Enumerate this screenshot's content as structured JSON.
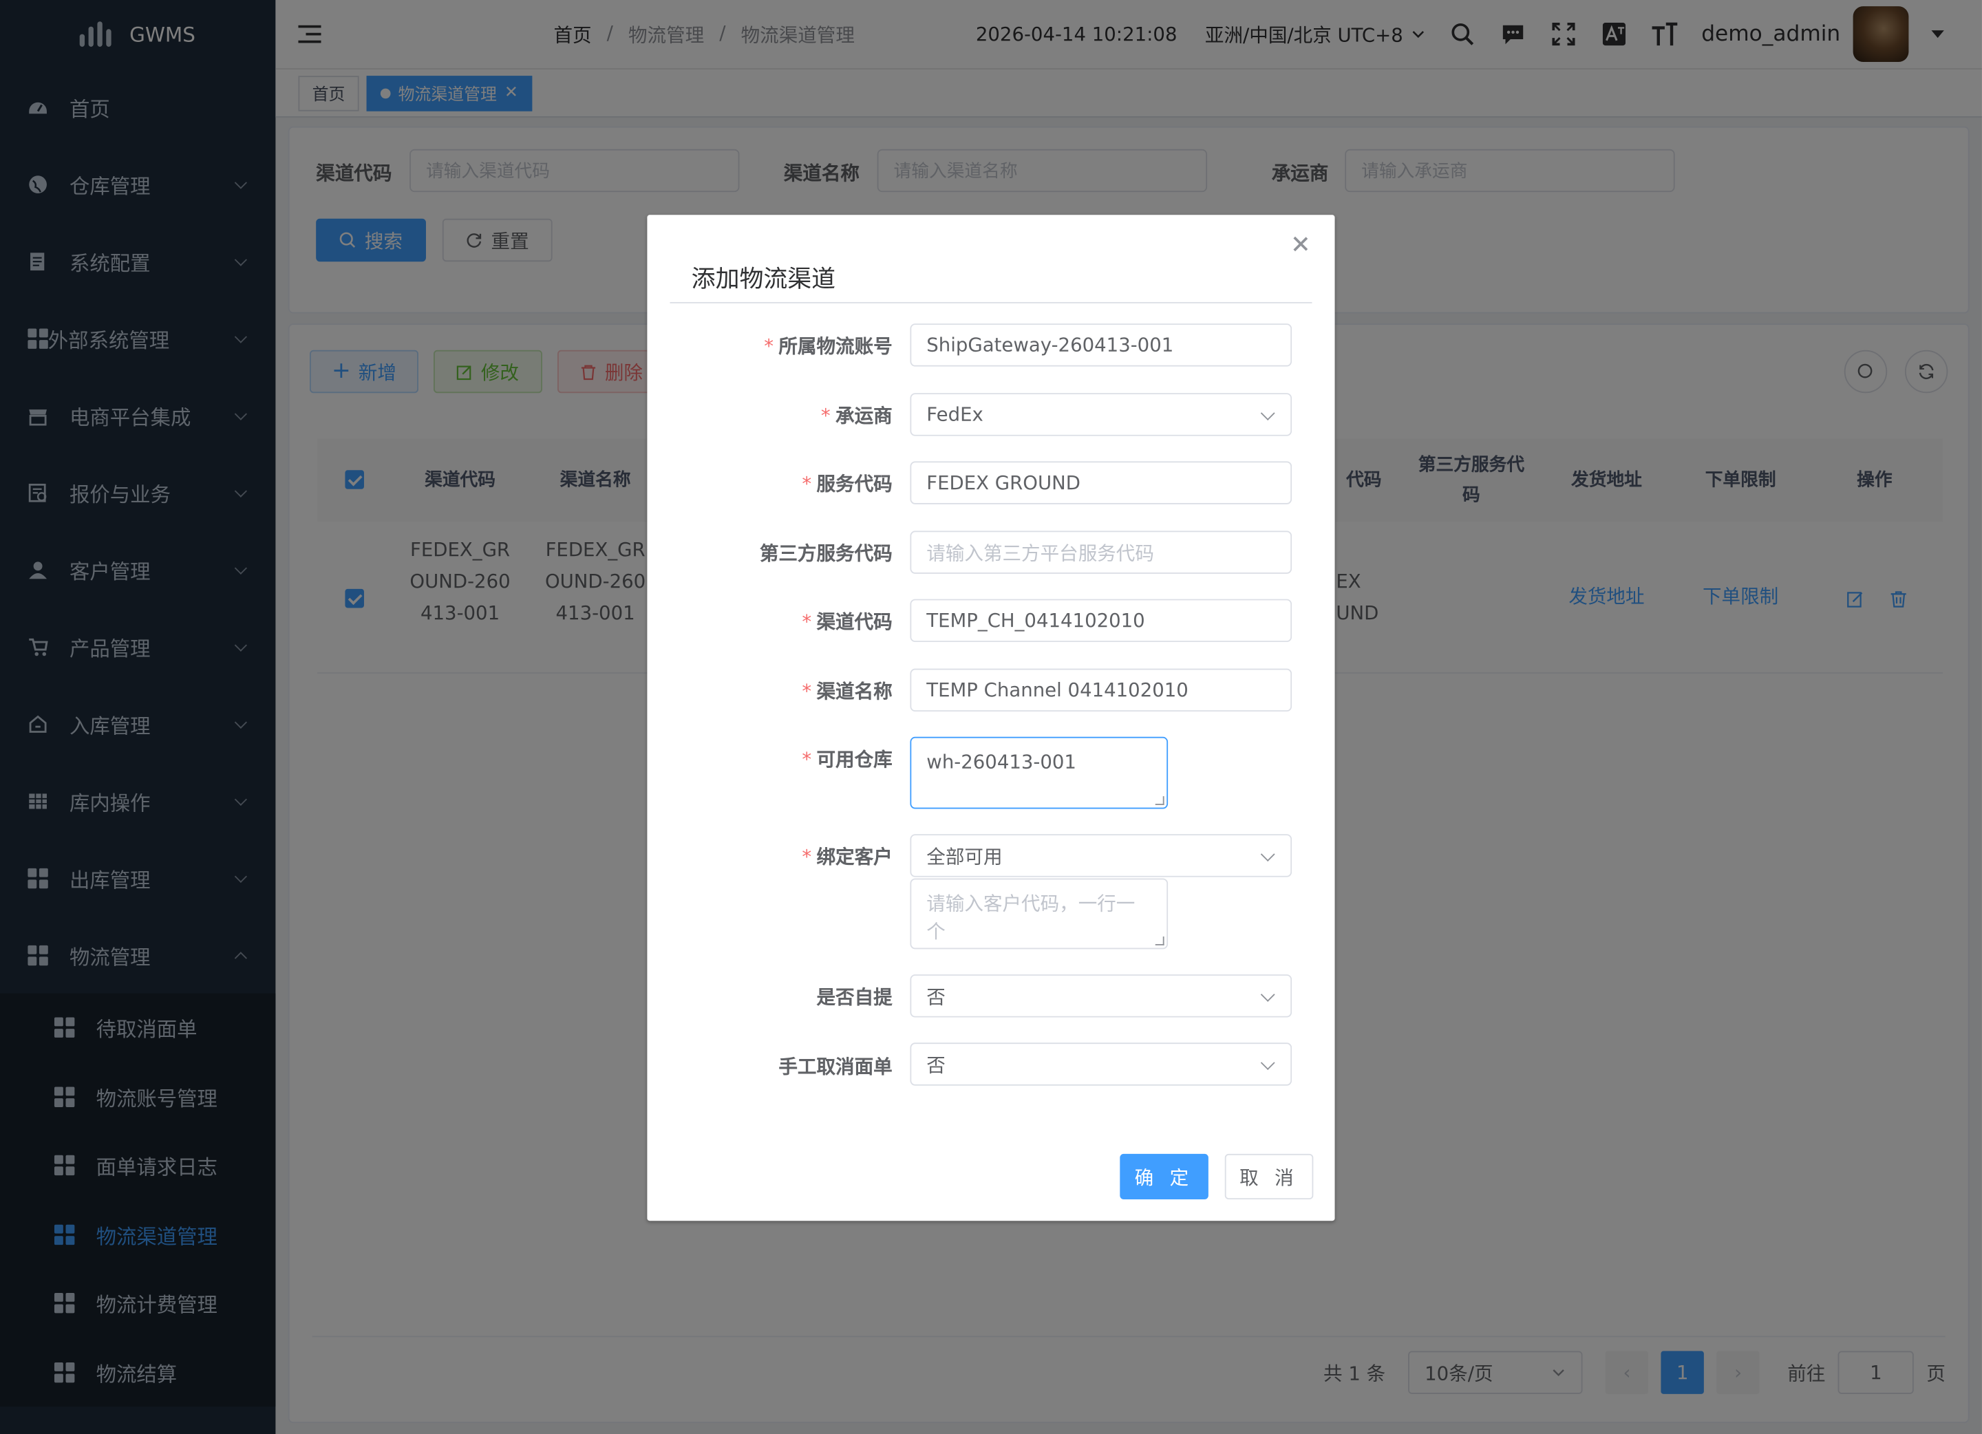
{
  "app": {
    "name": "GWMS"
  },
  "sidebar": {
    "items": [
      {
        "label": "首页",
        "icon": "dashboard-icon"
      },
      {
        "label": "仓库管理",
        "icon": "globe-icon"
      },
      {
        "label": "系统配置",
        "icon": "document-icon"
      },
      {
        "label": "外部系统管理",
        "icon": "grid-icon"
      },
      {
        "label": "电商平台集成",
        "icon": "store-icon"
      },
      {
        "label": "报价与业务",
        "icon": "quote-icon"
      },
      {
        "label": "客户管理",
        "icon": "user-icon"
      },
      {
        "label": "产品管理",
        "icon": "cart-icon"
      },
      {
        "label": "入库管理",
        "icon": "home-icon"
      },
      {
        "label": "库内操作",
        "icon": "table-icon"
      },
      {
        "label": "出库管理",
        "icon": "grid-icon"
      },
      {
        "label": "物流管理",
        "icon": "grid-icon"
      }
    ],
    "sub_items": [
      {
        "label": "待取消面单"
      },
      {
        "label": "物流账号管理"
      },
      {
        "label": "面单请求日志"
      },
      {
        "label": "物流渠道管理"
      },
      {
        "label": "物流计费管理"
      },
      {
        "label": "物流结算"
      }
    ]
  },
  "header": {
    "breadcrumb": [
      "首页",
      "物流管理",
      "物流渠道管理"
    ],
    "datetime": "2026-04-14 10:21:08",
    "timezone": "亚洲/中国/北京 UTC+8",
    "username": "demo_admin"
  },
  "tags": {
    "home": "首页",
    "current": "物流渠道管理"
  },
  "search": {
    "channel_code_label": "渠道代码",
    "channel_code_placeholder": "请输入渠道代码",
    "channel_name_label": "渠道名称",
    "channel_name_placeholder": "请输入渠道名称",
    "carrier_label": "承运商",
    "carrier_placeholder": "请输入承运商",
    "search_btn": "搜索",
    "reset_btn": "重置"
  },
  "toolbar": {
    "add": "新增",
    "edit": "修改",
    "delete": "删除"
  },
  "table": {
    "headers": {
      "channel_code": "渠道代码",
      "channel_name": "渠道名称",
      "service_code_partial": "代码",
      "third_party_code": "第三方服务代码",
      "ship_address": "发货地址",
      "order_limit": "下单限制",
      "actions": "操作"
    },
    "rows": [
      {
        "channel_code": "FEDEX_GROUND-260413-001",
        "channel_name": "FEDEX_GROUND-260413-001",
        "service_code_partial": "EX\nUND",
        "ship_address": "发货地址",
        "order_limit": "下单限制"
      }
    ]
  },
  "pagination": {
    "total": "共 1 条",
    "page_size": "10条/页",
    "current_page": "1",
    "goto_label": "前往",
    "goto_value": "1",
    "page_suffix": "页"
  },
  "dialog": {
    "title": "添加物流渠道",
    "fields": {
      "account_label": "所属物流账号",
      "account_value": "ShipGateway-260413-001",
      "carrier_label": "承运商",
      "carrier_value": "FedEx",
      "service_code_label": "服务代码",
      "service_code_value": "FEDEX GROUND",
      "third_party_label": "第三方服务代码",
      "third_party_placeholder": "请输入第三方平台服务代码",
      "channel_code_label": "渠道代码",
      "channel_code_value": "TEMP_CH_0414102010",
      "channel_name_label": "渠道名称",
      "channel_name_value": "TEMP Channel 0414102010",
      "warehouse_label": "可用仓库",
      "warehouse_value": "wh-260413-001",
      "customer_label": "绑定客户",
      "customer_value": "全部可用",
      "customer_placeholder": "请输入客户代码，一行一个",
      "self_pickup_label": "是否自提",
      "self_pickup_value": "否",
      "manual_cancel_label": "手工取消面单",
      "manual_cancel_value": "否"
    },
    "ok": "确 定",
    "cancel": "取 消"
  },
  "colors": {
    "primary": "#409eff",
    "sidebar_bg": "#1f2d3d",
    "danger": "#f56c6c",
    "success": "#67c23a"
  }
}
